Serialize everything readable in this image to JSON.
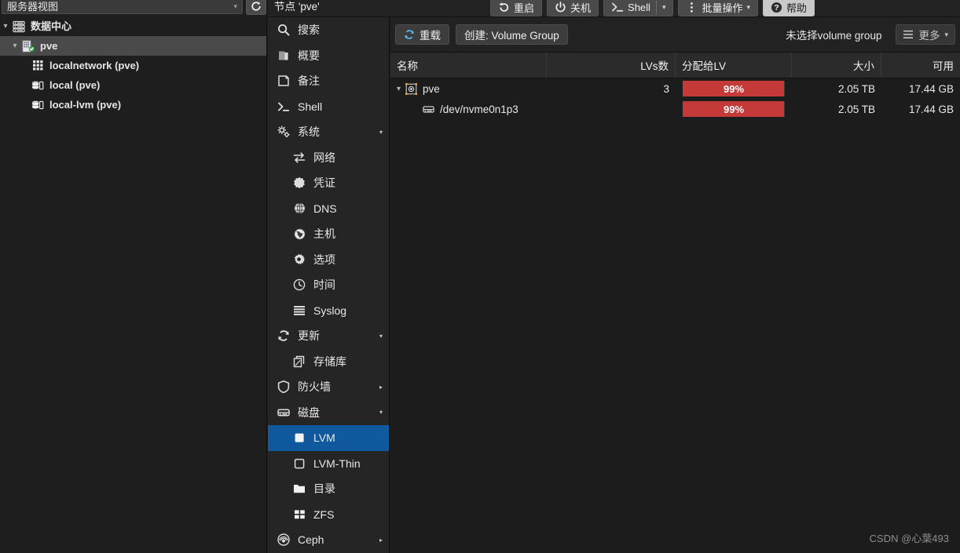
{
  "view_selector": {
    "label": "服务器视图",
    "arrow": "▾",
    "refresh_icon": "refresh-icon"
  },
  "tree": {
    "items": [
      {
        "label": "数据中心",
        "icon": "datacenter-icon",
        "level": 0,
        "caret": "▾",
        "selected": false,
        "bold": true
      },
      {
        "label": "pve",
        "icon": "node-icon",
        "level": 1,
        "caret": "▾",
        "selected": true,
        "bold": true
      },
      {
        "label": "localnetwork (pve)",
        "icon": "network-icon",
        "level": 2,
        "caret": "",
        "selected": false,
        "bold": true
      },
      {
        "label": "local (pve)",
        "icon": "storage-icon",
        "level": 2,
        "caret": "",
        "selected": false,
        "bold": true
      },
      {
        "label": "local-lvm (pve)",
        "icon": "storage-icon",
        "level": 2,
        "caret": "",
        "selected": false,
        "bold": true
      }
    ]
  },
  "header": {
    "title": "节点 'pve'",
    "buttons": [
      {
        "label": "重启",
        "icon": "restart-icon",
        "style": "dark",
        "caret": ""
      },
      {
        "label": "关机",
        "icon": "power-icon",
        "style": "dark",
        "caret": ""
      },
      {
        "label": "Shell",
        "icon": "terminal-icon",
        "style": "dark",
        "caret": "▾",
        "split": true
      },
      {
        "label": "批量操作",
        "icon": "kebab-icon",
        "style": "dark",
        "caret": "▾"
      },
      {
        "label": "帮助",
        "icon": "help-icon",
        "style": "light",
        "caret": ""
      }
    ]
  },
  "sidebar": {
    "items": [
      {
        "label": "搜索",
        "icon": "search-icon",
        "level": 0,
        "arrow": "",
        "active": false
      },
      {
        "label": "概要",
        "icon": "summary-icon",
        "level": 0,
        "arrow": "",
        "active": false
      },
      {
        "label": "备注",
        "icon": "notes-icon",
        "level": 0,
        "arrow": "",
        "active": false
      },
      {
        "label": "Shell",
        "icon": "terminal-icon",
        "level": 0,
        "arrow": "",
        "active": false
      },
      {
        "label": "系统",
        "icon": "system-icon",
        "level": 0,
        "arrow": "▾",
        "active": false
      },
      {
        "label": "网络",
        "icon": "network2-icon",
        "level": 1,
        "arrow": "",
        "active": false
      },
      {
        "label": "凭证",
        "icon": "certificate-icon",
        "level": 1,
        "arrow": "",
        "active": false
      },
      {
        "label": "DNS",
        "icon": "dns-icon",
        "level": 1,
        "arrow": "",
        "active": false
      },
      {
        "label": "主机",
        "icon": "hosts-icon",
        "level": 1,
        "arrow": "",
        "active": false
      },
      {
        "label": "选项",
        "icon": "options-icon",
        "level": 1,
        "arrow": "",
        "active": false
      },
      {
        "label": "时间",
        "icon": "clock-icon",
        "level": 1,
        "arrow": "",
        "active": false
      },
      {
        "label": "Syslog",
        "icon": "syslog-icon",
        "level": 1,
        "arrow": "",
        "active": false
      },
      {
        "label": "更新",
        "icon": "update-icon",
        "level": 0,
        "arrow": "▾",
        "active": false
      },
      {
        "label": "存储库",
        "icon": "repository-icon",
        "level": 1,
        "arrow": "",
        "active": false
      },
      {
        "label": "防火墙",
        "icon": "firewall-icon",
        "level": 0,
        "arrow": "▸",
        "active": false
      },
      {
        "label": "磁盘",
        "icon": "disk-icon",
        "level": 0,
        "arrow": "▾",
        "active": false
      },
      {
        "label": "LVM",
        "icon": "lvm-filled-icon",
        "level": 1,
        "arrow": "",
        "active": true
      },
      {
        "label": "LVM-Thin",
        "icon": "lvm-outline-icon",
        "level": 1,
        "arrow": "",
        "active": false
      },
      {
        "label": "目录",
        "icon": "folder-icon",
        "level": 1,
        "arrow": "",
        "active": false
      },
      {
        "label": "ZFS",
        "icon": "zfs-icon",
        "level": 1,
        "arrow": "",
        "active": false
      },
      {
        "label": "Ceph",
        "icon": "ceph-icon",
        "level": 0,
        "arrow": "▸",
        "active": false
      }
    ]
  },
  "content_toolbar": {
    "reload_label": "重载",
    "reload_icon": "refresh-icon",
    "create_vg_label": "创建: Volume Group",
    "no_selection_text": "未选择volume group",
    "more_label": "更多",
    "more_icon": "hamburger-icon",
    "more_caret": "▾"
  },
  "table": {
    "columns": [
      {
        "key": "name",
        "label": "名称",
        "align": "left"
      },
      {
        "key": "lvs",
        "label": "LVs数",
        "align": "right"
      },
      {
        "key": "alloc",
        "label": "分配给LV",
        "align": "left"
      },
      {
        "key": "size",
        "label": "大小",
        "align": "right"
      },
      {
        "key": "avail",
        "label": "可用",
        "align": "right"
      }
    ],
    "rows": [
      {
        "name": "pve",
        "icon": "volume-group-icon",
        "level": 0,
        "caret": "▾",
        "lvs": "3",
        "alloc_percent": 99,
        "alloc_label": "99%",
        "size": "2.05 TB",
        "avail": "17.44 GB"
      },
      {
        "name": "/dev/nvme0n1p3",
        "icon": "physical-volume-icon",
        "level": 1,
        "caret": "",
        "lvs": "",
        "alloc_percent": 99,
        "alloc_label": "99%",
        "size": "2.05 TB",
        "avail": "17.44 GB"
      }
    ]
  },
  "watermark": {
    "text": "CSDN @心葉493"
  },
  "colors": {
    "accent_blue": "#10599f",
    "progress_red": "#c33a38",
    "panel_bg": "#1e1e1e",
    "sidebar_bg": "#252525",
    "toolbar_bg": "#222222",
    "selected_row": "#4a4a4a",
    "status_ok_green": "#2eaa4b"
  }
}
